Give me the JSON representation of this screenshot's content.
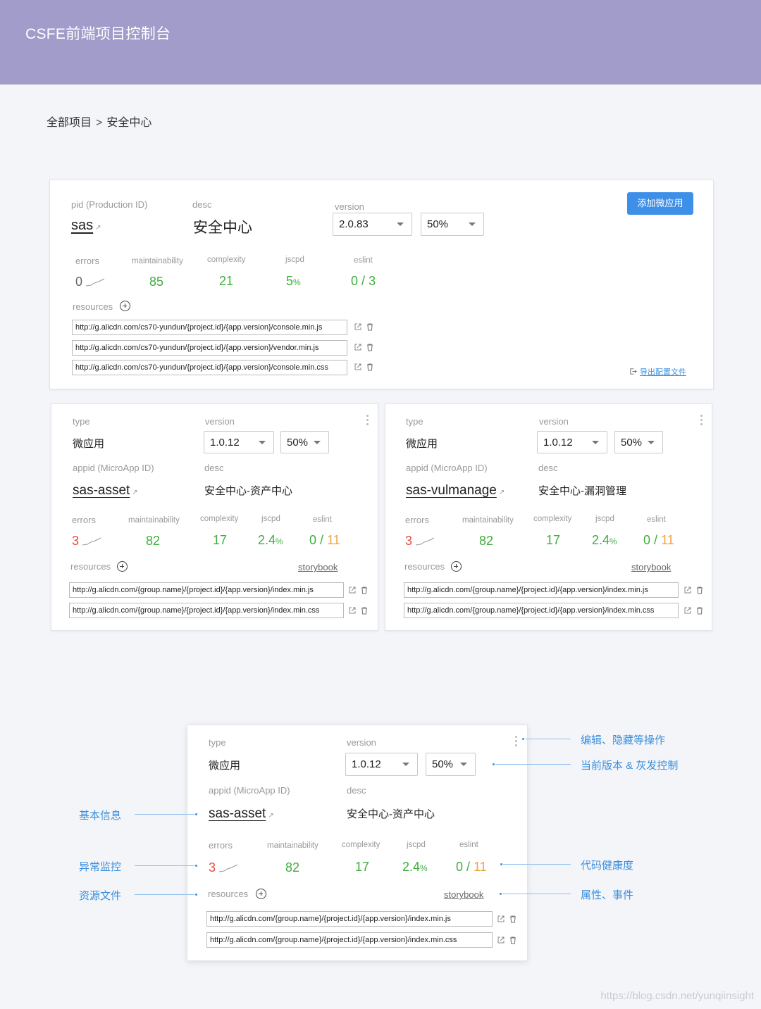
{
  "header": {
    "title": "CSFE前端项目控制台"
  },
  "breadcrumb": {
    "root": "全部项目",
    "separator": ">",
    "current": "安全中心"
  },
  "project": {
    "pid_label": "pid (Production ID)",
    "pid": "sas",
    "desc_label": "desc",
    "desc": "安全中心",
    "version_label": "version",
    "version": "2.0.83",
    "gray": "50%",
    "add_button": "添加微应用",
    "metrics": {
      "errors_label": "errors",
      "errors": "0",
      "maintainability_label": "maintainability",
      "maintainability": "85",
      "complexity_label": "complexity",
      "complexity": "21",
      "jscpd_label": "jscpd",
      "jscpd": "5",
      "jscpd_unit": "%",
      "eslint_label": "eslint",
      "eslint_a": "0",
      "eslint_sep": "/",
      "eslint_b": "3"
    },
    "resources_label": "resources",
    "resources": [
      "http://g.alicdn.com/cs70-yundun/{project.id}/{app.version}/console.min.js",
      "http://g.alicdn.com/cs70-yundun/{project.id}/{app.version}/vendor.min.js",
      "http://g.alicdn.com/cs70-yundun/{project.id}/{app.version}/console.min.css"
    ],
    "export_label": "导出配置文件"
  },
  "apps": [
    {
      "type_label": "type",
      "type": "微应用",
      "version_label": "version",
      "version": "1.0.12",
      "gray": "50%",
      "appid_label": "appid (MicroApp ID)",
      "appid": "sas-asset",
      "desc_label": "desc",
      "desc": "安全中心-资产中心",
      "metrics": {
        "errors_label": "errors",
        "errors": "3",
        "maintainability_label": "maintainability",
        "maintainability": "82",
        "complexity_label": "complexity",
        "complexity": "17",
        "jscpd_label": "jscpd",
        "jscpd": "2.4",
        "jscpd_unit": "%",
        "eslint_label": "eslint",
        "eslint_a": "0",
        "eslint_sep": "/",
        "eslint_b": "11"
      },
      "resources_label": "resources",
      "storybook": "storybook",
      "resources": [
        "http://g.alicdn.com/{group.name}/{project.id}/{app.version}/index.min.js",
        "http://g.alicdn.com/{group.name}/{project.id}/{app.version}/index.min.css"
      ]
    },
    {
      "type_label": "type",
      "type": "微应用",
      "version_label": "version",
      "version": "1.0.12",
      "gray": "50%",
      "appid_label": "appid (MicroApp ID)",
      "appid": "sas-vulmanage",
      "desc_label": "desc",
      "desc": "安全中心-漏洞管理",
      "metrics": {
        "errors_label": "errors",
        "errors": "3",
        "maintainability_label": "maintainability",
        "maintainability": "82",
        "complexity_label": "complexity",
        "complexity": "17",
        "jscpd_label": "jscpd",
        "jscpd": "2.4",
        "jscpd_unit": "%",
        "eslint_label": "eslint",
        "eslint_a": "0",
        "eslint_sep": "/",
        "eslint_b": "11"
      },
      "resources_label": "resources",
      "storybook": "storybook",
      "resources": [
        "http://g.alicdn.com/{group.name}/{project.id}/{app.version}/index.min.js",
        "http://g.alicdn.com/{group.name}/{project.id}/{app.version}/index.min.css"
      ]
    }
  ],
  "detail": {
    "type_label": "type",
    "type": "微应用",
    "version_label": "version",
    "version": "1.0.12",
    "gray": "50%",
    "appid_label": "appid (MicroApp ID)",
    "appid": "sas-asset",
    "desc_label": "desc",
    "desc": "安全中心-资产中心",
    "metrics": {
      "errors_label": "errors",
      "errors": "3",
      "maintainability_label": "maintainability",
      "maintainability": "82",
      "complexity_label": "complexity",
      "complexity": "17",
      "jscpd_label": "jscpd",
      "jscpd": "2.4",
      "jscpd_unit": "%",
      "eslint_label": "eslint",
      "eslint_a": "0",
      "eslint_sep": "/",
      "eslint_b": "11"
    },
    "resources_label": "resources",
    "storybook": "storybook",
    "resources": [
      "http://g.alicdn.com/{group.name}/{project.id}/{app.version}/index.min.js",
      "http://g.alicdn.com/{group.name}/{project.id}/{app.version}/index.min.css"
    ]
  },
  "annotations": {
    "edit_hide": "编辑、隐藏等操作",
    "version_gray": "当前版本 & 灰发控制",
    "basic_info": "基本信息",
    "error_monitor": "异常监控",
    "code_health": "代码健康度",
    "resource_files": "资源文件",
    "props_events": "属性、事件"
  },
  "watermark": "https://blog.csdn.net/yunqiinsight",
  "colors": {
    "header_bg": "#a19cc9",
    "primary": "#3d8fe8",
    "success": "#3fae3c",
    "danger": "#e94b3c",
    "warning": "#f2a33a",
    "annotation": "#3a8fdc"
  }
}
